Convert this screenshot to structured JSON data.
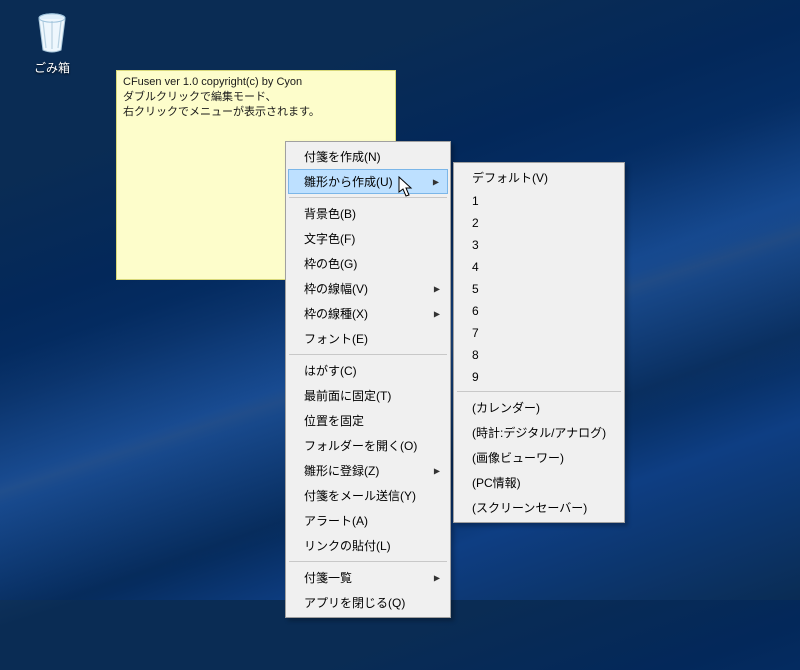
{
  "desktop": {
    "recycle_bin_label": "ごみ箱"
  },
  "sticky": {
    "line1": "CFusen ver 1.0 copyright(c) by Cyon",
    "line2": "ダブルクリックで編集モード、",
    "line3": "右クリックでメニューが表示されます。"
  },
  "context_menu": {
    "items": [
      {
        "label": "付箋を作成(N)"
      },
      {
        "label": "雛形から作成(U)",
        "submenu": true,
        "highlighted": true
      },
      {
        "sep": true
      },
      {
        "label": "背景色(B)"
      },
      {
        "label": "文字色(F)"
      },
      {
        "label": "枠の色(G)"
      },
      {
        "label": "枠の線幅(V)",
        "submenu": true
      },
      {
        "label": "枠の線種(X)",
        "submenu": true
      },
      {
        "label": "フォント(E)"
      },
      {
        "sep": true
      },
      {
        "label": "はがす(C)"
      },
      {
        "label": "最前面に固定(T)"
      },
      {
        "label": "位置を固定"
      },
      {
        "label": "フォルダーを開く(O)"
      },
      {
        "label": "雛形に登録(Z)",
        "submenu": true
      },
      {
        "label": "付箋をメール送信(Y)"
      },
      {
        "label": "アラート(A)"
      },
      {
        "label": "リンクの貼付(L)"
      },
      {
        "sep": true
      },
      {
        "label": "付箋一覧",
        "submenu": true
      },
      {
        "label": "アプリを閉じる(Q)"
      }
    ]
  },
  "submenu": {
    "items": [
      {
        "label": "デフォルト(V)"
      },
      {
        "label": "1"
      },
      {
        "label": "2"
      },
      {
        "label": "3"
      },
      {
        "label": "4"
      },
      {
        "label": "5"
      },
      {
        "label": "6"
      },
      {
        "label": "7"
      },
      {
        "label": "8"
      },
      {
        "label": "9"
      },
      {
        "sep": true
      },
      {
        "label": "(カレンダー)"
      },
      {
        "label": "(時計:デジタル/アナログ)"
      },
      {
        "label": "(画像ビューワー)"
      },
      {
        "label": "(PC情報)"
      },
      {
        "label": "(スクリーンセーバー)"
      }
    ]
  }
}
